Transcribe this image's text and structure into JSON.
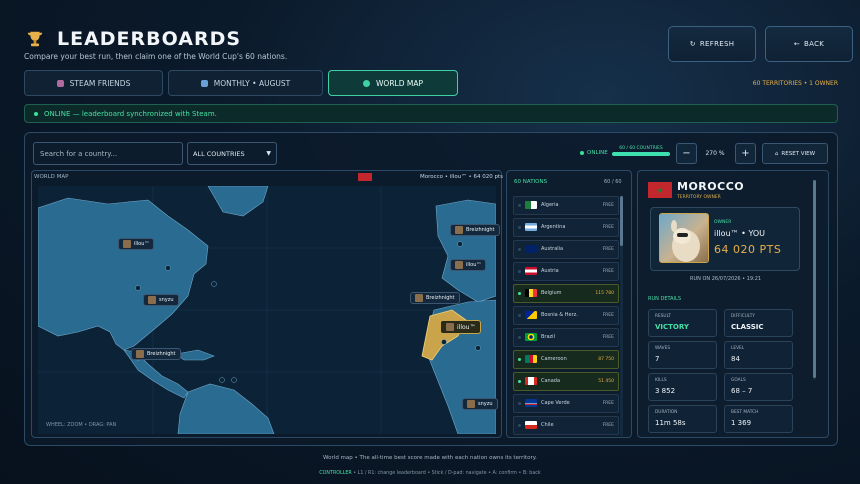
{
  "header": {
    "title": "LEADERBOARDS",
    "subtitle": "Compare your best run, then claim one of the World Cup's 60 nations.",
    "refresh_label": "REFRESH",
    "back_label": "BACK",
    "territories_info": "60 TERRITORIES • 1 OWNER"
  },
  "tabs": [
    {
      "label": "STEAM FRIENDS",
      "icon": "friends-icon",
      "active": false
    },
    {
      "label": "MONTHLY • AUGUST",
      "icon": "calendar-icon",
      "active": false
    },
    {
      "label": "WORLD MAP",
      "icon": "globe-icon",
      "active": true
    }
  ],
  "status": {
    "text": "ONLINE — leaderboard synchronized with Steam.",
    "color": "#39e19a"
  },
  "toolbar": {
    "search_placeholder": "Search for a country...",
    "filter_value": "ALL COUNTRIES",
    "online_label": "ONLINE",
    "progress_label": "60 / 60 COUNTRIES",
    "progress_fraction": 1.0,
    "zoom_out": "−",
    "zoom_value": "270 %",
    "zoom_in": "+",
    "reset_label": "RESET VIEW"
  },
  "map": {
    "label": "WORLD MAP",
    "selected": "Morocco • illou™ • 64 020 pts",
    "hint": "WHEEL: ZOOM • DRAG: PAN",
    "markers": [
      {
        "name": "illou™"
      },
      {
        "name": "Breizhnight"
      },
      {
        "name": "illou™"
      },
      {
        "name": "snyzu"
      },
      {
        "name": "Breizhnight"
      },
      {
        "name": "Breizhnight"
      },
      {
        "name": "illou™"
      },
      {
        "name": "snyzu"
      }
    ]
  },
  "nations": {
    "header": "60 NATIONS",
    "count": "60 / 60",
    "items": [
      {
        "name": "Algeria",
        "score": "FREE",
        "owned": false
      },
      {
        "name": "Argentina",
        "score": "FREE",
        "owned": false
      },
      {
        "name": "Australia",
        "score": "FREE",
        "owned": false
      },
      {
        "name": "Austria",
        "score": "FREE",
        "owned": false
      },
      {
        "name": "Belgium",
        "score": "115 780",
        "owned": true
      },
      {
        "name": "Bosnia & Herz.",
        "score": "FREE",
        "owned": false
      },
      {
        "name": "Brazil",
        "score": "FREE",
        "owned": false
      },
      {
        "name": "Cameroon",
        "score": "87 750",
        "owned": true
      },
      {
        "name": "Canada",
        "score": "51 450",
        "owned": true
      },
      {
        "name": "Cape Verde",
        "score": "FREE",
        "owned": false
      },
      {
        "name": "Chile",
        "score": "FREE",
        "owned": false
      }
    ]
  },
  "details": {
    "country": "MOROCCO",
    "owner_tag": "TERRITORY OWNER",
    "owner_label": "OWNER",
    "owner_name": "illou™ • YOU",
    "points": "64 020 PTS",
    "run_on": "RUN ON 26/07/2026 • 19:21",
    "run_details_label": "RUN DETAILS",
    "stats": [
      {
        "label": "RESULT",
        "value": "VICTORY"
      },
      {
        "label": "DIFFICULTY",
        "value": "CLASSIC"
      },
      {
        "label": "WAVES",
        "value": "7"
      },
      {
        "label": "LEVEL",
        "value": "84"
      },
      {
        "label": "KILLS",
        "value": "3 852"
      },
      {
        "label": "GOALS",
        "value": "68 – 7"
      },
      {
        "label": "DURATION",
        "value": "11m 58s"
      },
      {
        "label": "BEST MATCH",
        "value": "1 369"
      }
    ]
  },
  "footer": {
    "note": "World map • The all-time best score made with each nation owns its territory.",
    "controller_label": "CONTROLLER",
    "controls": "• L1 / R1: change leaderboard • Stick / D-pad: navigate • A: confirm • B: back"
  },
  "colors": {
    "accent": "#45e0a4",
    "gold": "#e6b04a",
    "morocco_red": "#c1272d"
  }
}
